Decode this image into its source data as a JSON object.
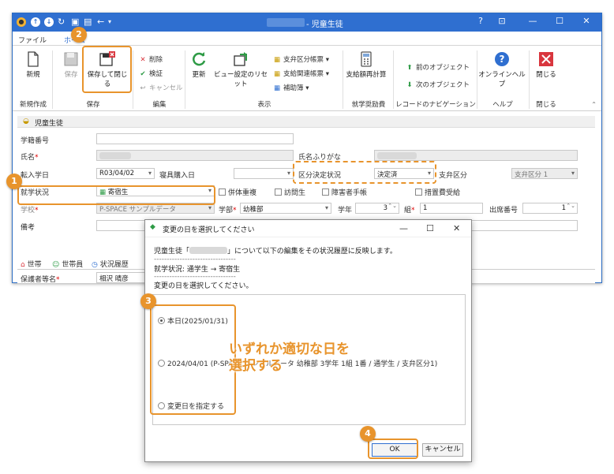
{
  "window": {
    "title": "- 児童生徒",
    "buttons": {
      "help": "?",
      "options": "⊡",
      "minimize": "—",
      "maximize": "☐",
      "close": "✕"
    }
  },
  "tabs": [
    "ファイル",
    "ホーム"
  ],
  "ribbon": {
    "new_label": "新規",
    "save_label": "保存",
    "save_close_label": "保存して閉じる",
    "delete_label": "削除",
    "verify_label": "検証",
    "cancel_label": "キャンセル",
    "refresh_label": "更新",
    "view_reset_label": "ビュー設定のリセット",
    "report1_label": "支弁区分帳票",
    "report2_label": "支給関連帳票",
    "report3_label": "補助簿",
    "calc_label": "支給額再計算",
    "prev_label": "前のオブジェクト",
    "next_label": "次のオブジェクト",
    "online_help_label": "オンラインヘルプ",
    "close_label": "閉じる",
    "groups": {
      "create": "新規作成",
      "save": "保存",
      "edit": "編集",
      "display": "表示",
      "support": "就学奨励費",
      "nav": "レコードのナビゲーション",
      "help": "ヘルプ",
      "close": "閉じる"
    }
  },
  "form": {
    "header": "児童生徒",
    "student_no_label": "学籍番号",
    "name_label": "氏名",
    "kana_label": "氏名ふりがな",
    "transfer_in_label": "転入学日",
    "transfer_in_value": "R03/04/02",
    "dorm_date_label": "寝具購入日",
    "division_status_label": "区分決定状況",
    "division_status_value": "決定済",
    "support_div_label": "支弁区分",
    "support_div_value": "支弁区分 1",
    "enroll_status_label": "就学状況",
    "enroll_status_value": "寄宿生",
    "check_overlap": "併体重複",
    "check_visit": "訪問生",
    "check_disability": "障害者手帳",
    "check_measure": "措置費受給",
    "school_label": "学校",
    "school_value": "P-SPACE サンプルデータ",
    "dept_label": "学部",
    "dept_value": "幼稚部",
    "grade_label": "学年",
    "grade_value": "3",
    "class_label": "組",
    "class_value": "1",
    "attendance_label": "出席番号",
    "attendance_value": "1",
    "remarks_label": "備考",
    "subtabs": [
      "世帯",
      "世帯員",
      "状況履歴"
    ],
    "guardian_label": "保護者等名",
    "guardian_value": "相沢 晴彦"
  },
  "dialog": {
    "title": "変更の日を選択してください",
    "message_prefix": "児童生徒「",
    "message_suffix": "」について以下の編集をその状況履歴に反映します。",
    "separator": "--------------------------------",
    "change_line": "就学状況: 通学生 → 寄宿生",
    "prompt": "変更の日を選択してください。",
    "option_today": "本日(2025/01/31)",
    "option_history": "2024/04/01 (P-SPACE サンプルデータ 幼稚部 3学年 1組 1番 / 通学生 / 支弁区分1)",
    "option_custom": "変更日を指定する",
    "ok_label": "OK",
    "cancel_label": "キャンセル"
  },
  "annotations": {
    "badge1": "1",
    "badge2": "2",
    "badge3": "3",
    "badge4": "4",
    "note_line1": "いずれか適切な日を",
    "note_line2": "選択する"
  },
  "colors": {
    "accent": "#2f6fd0",
    "highlight": "#e8942c",
    "danger": "#d9363e",
    "ok_green": "#2e9b46"
  }
}
